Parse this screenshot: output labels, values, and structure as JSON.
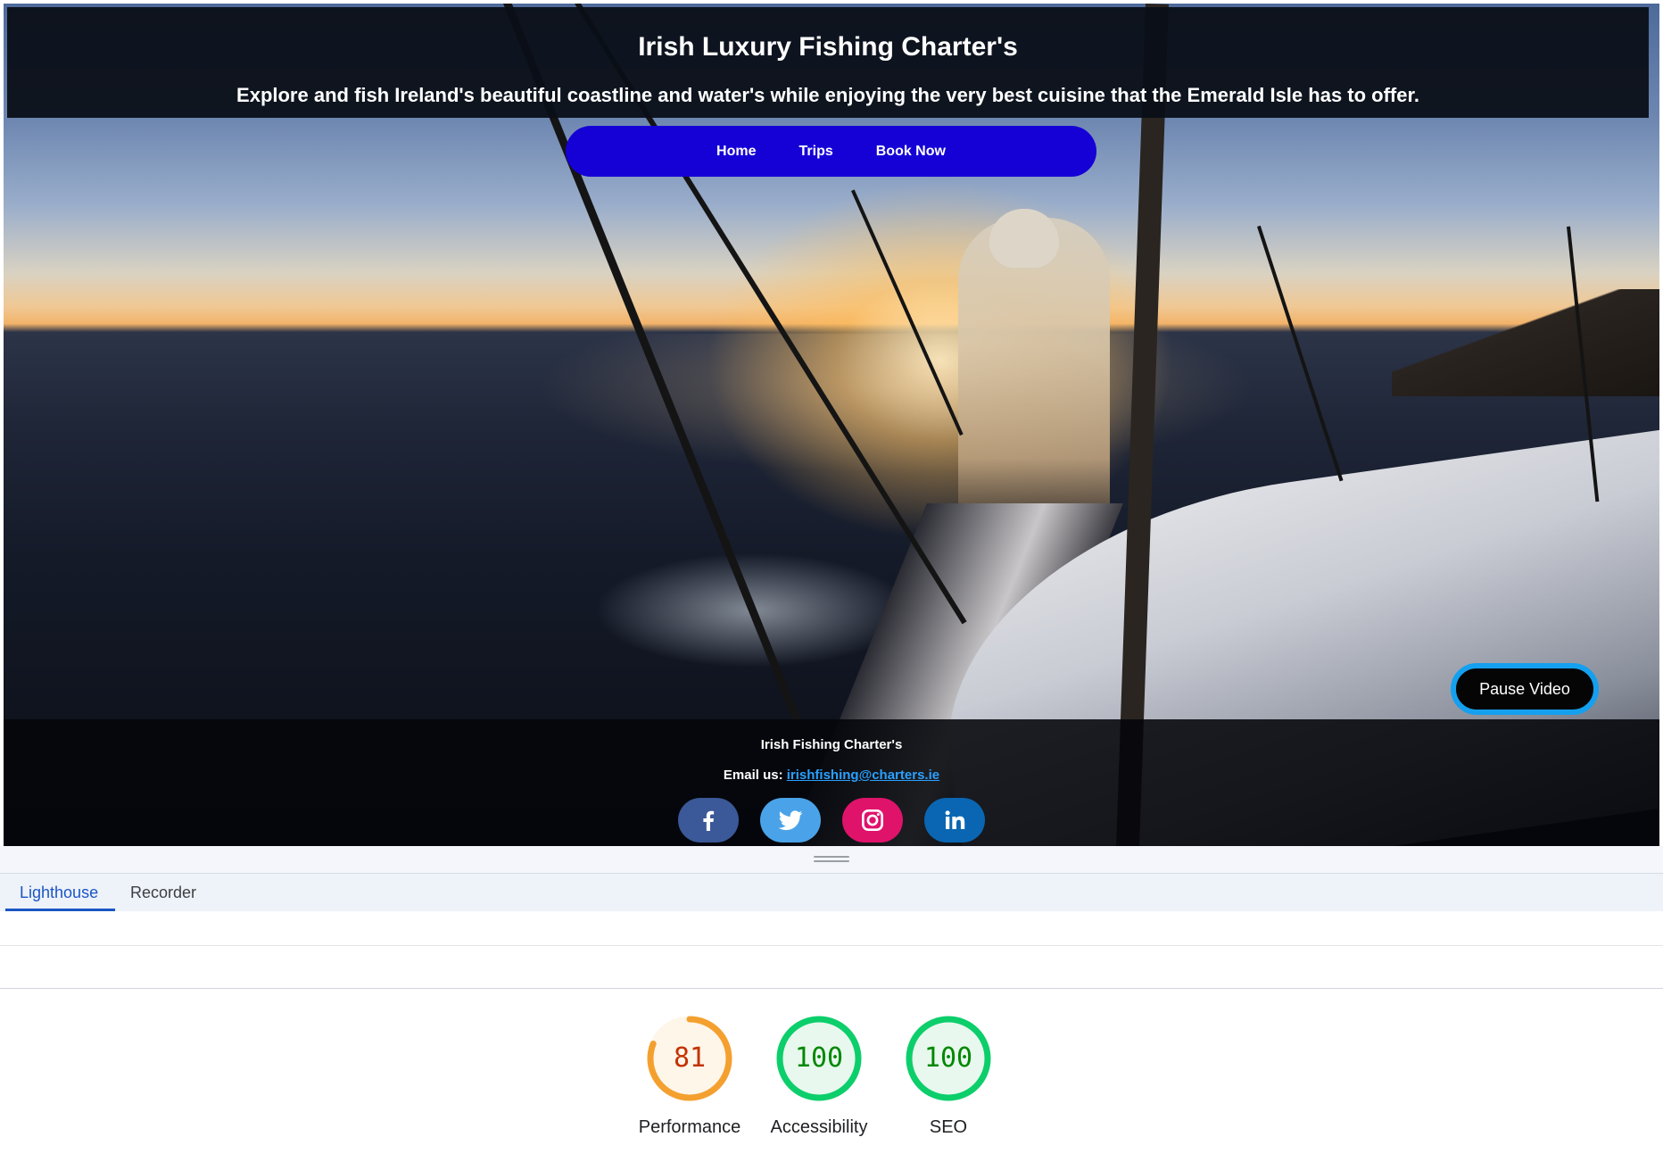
{
  "site": {
    "title": "Irish Luxury Fishing Charter's",
    "tagline": "Explore and fish Ireland's beautiful coastline and water's while enjoying the very best cuisine that the Emerald Isle has to offer.",
    "nav": [
      {
        "label": "Home"
      },
      {
        "label": "Trips"
      },
      {
        "label": "Book Now"
      }
    ],
    "pause_button": "Pause Video",
    "footer": {
      "name": "Irish Fishing Charter's",
      "email_label": "Email us:",
      "email": "irishfishing@charters.ie",
      "socials": [
        {
          "icon": "facebook-icon",
          "color": "#3b5998"
        },
        {
          "icon": "twitter-icon",
          "color": "#4aa3e8"
        },
        {
          "icon": "instagram-icon",
          "color": "#e0136b"
        },
        {
          "icon": "linkedin-icon",
          "color": "#0a66b2"
        }
      ]
    },
    "colors": {
      "nav_bg": "#1500d6",
      "pause_border": "#14a0ef",
      "link": "#2aa0ff"
    }
  },
  "devtools": {
    "tabs": [
      {
        "label": "Lighthouse",
        "active": true
      },
      {
        "label": "Recorder",
        "active": false
      }
    ],
    "scores": [
      {
        "label": "Performance",
        "value": 81,
        "color": "#f4a02f",
        "text_color": "#c33300",
        "fill": "#fff6ea"
      },
      {
        "label": "Accessibility",
        "value": 100,
        "color": "#0cce6b",
        "text_color": "#008800",
        "fill": "#e8f8ee"
      },
      {
        "label": "SEO",
        "value": 100,
        "color": "#0cce6b",
        "text_color": "#008800",
        "fill": "#e8f8ee"
      }
    ]
  }
}
